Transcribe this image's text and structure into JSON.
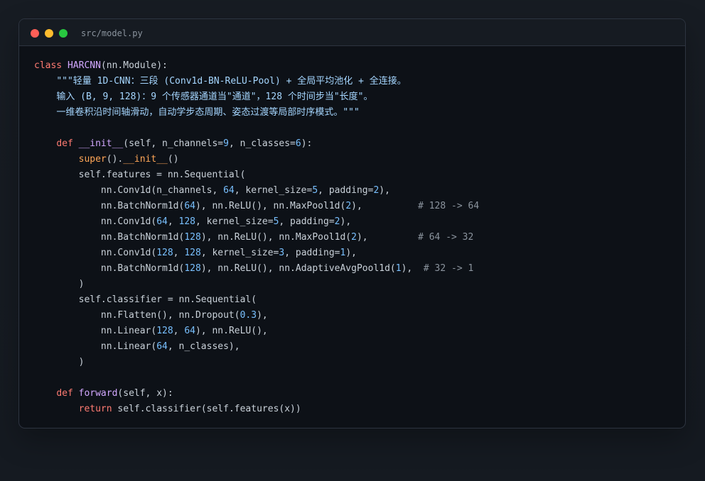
{
  "window": {
    "title": "src/model.py"
  },
  "colors": {
    "keyword": "#ff7b72",
    "class_name": "#d2a8ff",
    "function": "#d2a8ff",
    "builtin": "#ffa657",
    "docstring": "#a5d6ff",
    "number": "#79c0ff",
    "comment": "#8b949e",
    "plain": "#c9d1d9"
  },
  "code": {
    "lines": [
      [
        {
          "text": "class",
          "kind": "kw"
        },
        {
          "text": " ",
          "kind": "plain"
        },
        {
          "text": "HARCNN",
          "kind": "class"
        },
        {
          "text": "(nn.Module):",
          "kind": "plain"
        }
      ],
      [
        {
          "text": "    ",
          "kind": "plain"
        },
        {
          "text": "\"\"\"轻量 1D-CNN：三段 (Conv1d-BN-ReLU-Pool) + 全局平均池化 + 全连接。",
          "kind": "doc"
        }
      ],
      [
        {
          "text": "    ",
          "kind": "plain"
        },
        {
          "text": "输入 (B, 9, 128)：9 个传感器通道当\"通道\"，128 个时间步当\"长度\"。",
          "kind": "doc"
        }
      ],
      [
        {
          "text": "    ",
          "kind": "plain"
        },
        {
          "text": "一维卷积沿时间轴滑动，自动学步态周期、姿态过渡等局部时序模式。\"\"\"",
          "kind": "doc"
        }
      ],
      [
        {
          "text": "",
          "kind": "plain"
        }
      ],
      [
        {
          "text": "    ",
          "kind": "plain"
        },
        {
          "text": "def",
          "kind": "kw"
        },
        {
          "text": " ",
          "kind": "plain"
        },
        {
          "text": "__init__",
          "kind": "func"
        },
        {
          "text": "(self, n_channels=",
          "kind": "plain"
        },
        {
          "text": "9",
          "kind": "num"
        },
        {
          "text": ", n_classes=",
          "kind": "plain"
        },
        {
          "text": "6",
          "kind": "num"
        },
        {
          "text": "):",
          "kind": "plain"
        }
      ],
      [
        {
          "text": "        ",
          "kind": "plain"
        },
        {
          "text": "super",
          "kind": "builtin"
        },
        {
          "text": "().",
          "kind": "plain"
        },
        {
          "text": "__init__",
          "kind": "builtin"
        },
        {
          "text": "()",
          "kind": "plain"
        }
      ],
      [
        {
          "text": "        self.features = nn.Sequential(",
          "kind": "plain"
        }
      ],
      [
        {
          "text": "            nn.Conv1d(n_channels, ",
          "kind": "plain"
        },
        {
          "text": "64",
          "kind": "num"
        },
        {
          "text": ", kernel_size=",
          "kind": "plain"
        },
        {
          "text": "5",
          "kind": "num"
        },
        {
          "text": ", padding=",
          "kind": "plain"
        },
        {
          "text": "2",
          "kind": "num"
        },
        {
          "text": "),",
          "kind": "plain"
        }
      ],
      [
        {
          "text": "            nn.BatchNorm1d(",
          "kind": "plain"
        },
        {
          "text": "64",
          "kind": "num"
        },
        {
          "text": "), nn.ReLU(), nn.MaxPool1d(",
          "kind": "plain"
        },
        {
          "text": "2",
          "kind": "num"
        },
        {
          "text": "),          ",
          "kind": "plain"
        },
        {
          "text": "# 128 -> 64",
          "kind": "comment"
        }
      ],
      [
        {
          "text": "            nn.Conv1d(",
          "kind": "plain"
        },
        {
          "text": "64",
          "kind": "num"
        },
        {
          "text": ", ",
          "kind": "plain"
        },
        {
          "text": "128",
          "kind": "num"
        },
        {
          "text": ", kernel_size=",
          "kind": "plain"
        },
        {
          "text": "5",
          "kind": "num"
        },
        {
          "text": ", padding=",
          "kind": "plain"
        },
        {
          "text": "2",
          "kind": "num"
        },
        {
          "text": "),",
          "kind": "plain"
        }
      ],
      [
        {
          "text": "            nn.BatchNorm1d(",
          "kind": "plain"
        },
        {
          "text": "128",
          "kind": "num"
        },
        {
          "text": "), nn.ReLU(), nn.MaxPool1d(",
          "kind": "plain"
        },
        {
          "text": "2",
          "kind": "num"
        },
        {
          "text": "),         ",
          "kind": "plain"
        },
        {
          "text": "# 64 -> 32",
          "kind": "comment"
        }
      ],
      [
        {
          "text": "            nn.Conv1d(",
          "kind": "plain"
        },
        {
          "text": "128",
          "kind": "num"
        },
        {
          "text": ", ",
          "kind": "plain"
        },
        {
          "text": "128",
          "kind": "num"
        },
        {
          "text": ", kernel_size=",
          "kind": "plain"
        },
        {
          "text": "3",
          "kind": "num"
        },
        {
          "text": ", padding=",
          "kind": "plain"
        },
        {
          "text": "1",
          "kind": "num"
        },
        {
          "text": "),",
          "kind": "plain"
        }
      ],
      [
        {
          "text": "            nn.BatchNorm1d(",
          "kind": "plain"
        },
        {
          "text": "128",
          "kind": "num"
        },
        {
          "text": "), nn.ReLU(), nn.AdaptiveAvgPool1d(",
          "kind": "plain"
        },
        {
          "text": "1",
          "kind": "num"
        },
        {
          "text": "),  ",
          "kind": "plain"
        },
        {
          "text": "# 32 -> 1",
          "kind": "comment"
        }
      ],
      [
        {
          "text": "        )",
          "kind": "plain"
        }
      ],
      [
        {
          "text": "        self.classifier = nn.Sequential(",
          "kind": "plain"
        }
      ],
      [
        {
          "text": "            nn.Flatten(), nn.Dropout(",
          "kind": "plain"
        },
        {
          "text": "0.3",
          "kind": "num"
        },
        {
          "text": "),",
          "kind": "plain"
        }
      ],
      [
        {
          "text": "            nn.Linear(",
          "kind": "plain"
        },
        {
          "text": "128",
          "kind": "num"
        },
        {
          "text": ", ",
          "kind": "plain"
        },
        {
          "text": "64",
          "kind": "num"
        },
        {
          "text": "), nn.ReLU(),",
          "kind": "plain"
        }
      ],
      [
        {
          "text": "            nn.Linear(",
          "kind": "plain"
        },
        {
          "text": "64",
          "kind": "num"
        },
        {
          "text": ", n_classes),",
          "kind": "plain"
        }
      ],
      [
        {
          "text": "        )",
          "kind": "plain"
        }
      ],
      [
        {
          "text": "",
          "kind": "plain"
        }
      ],
      [
        {
          "text": "    ",
          "kind": "plain"
        },
        {
          "text": "def",
          "kind": "kw"
        },
        {
          "text": " ",
          "kind": "plain"
        },
        {
          "text": "forward",
          "kind": "func"
        },
        {
          "text": "(self, x):",
          "kind": "plain"
        }
      ],
      [
        {
          "text": "        ",
          "kind": "plain"
        },
        {
          "text": "return",
          "kind": "kw"
        },
        {
          "text": " self.classifier(self.features(x))",
          "kind": "plain"
        }
      ]
    ]
  }
}
